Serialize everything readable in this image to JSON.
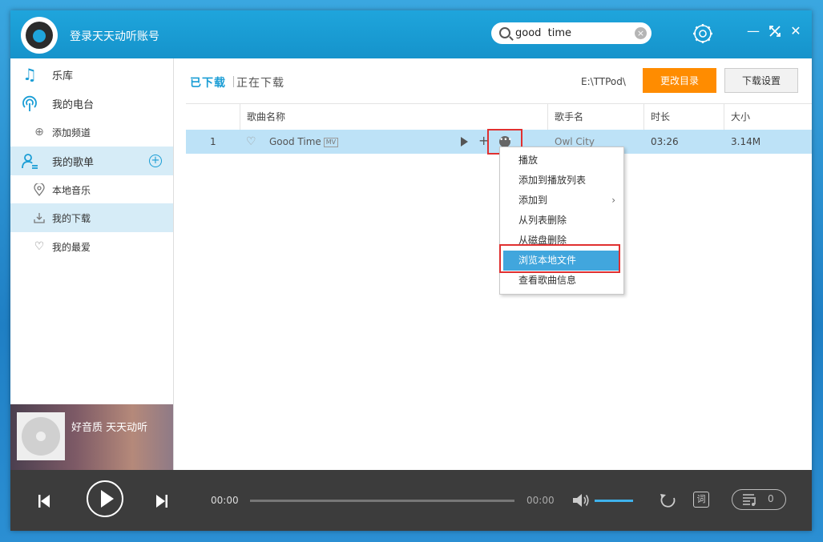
{
  "header": {
    "login_label": "登录天天动听账号",
    "search_value": "good  time",
    "search_clear": "×"
  },
  "window_controls": {
    "minimize": "—",
    "restore": "✕",
    "close": "✕"
  },
  "sidebar": {
    "items": [
      {
        "label": "乐库"
      },
      {
        "label": "我的电台"
      },
      {
        "label": "添加频道"
      },
      {
        "label": "我的歌单"
      },
      {
        "label": "本地音乐"
      },
      {
        "label": "我的下载"
      },
      {
        "label": "我的最爱"
      }
    ],
    "add_symbol": "+",
    "promo_text": "好音质 天天动听"
  },
  "main": {
    "tabs": [
      {
        "label": "已下载"
      },
      {
        "label": "正在下载"
      }
    ],
    "path": "E:\\TTPod\\",
    "change_dir_label": "更改目录",
    "download_settings_label": "下载设置",
    "columns": [
      "歌曲名称",
      "歌手名",
      "时长",
      "大小"
    ],
    "rows": [
      {
        "index": "1",
        "title": "Good Time",
        "mv": "MV",
        "artist": "Owl City",
        "duration": "03:26",
        "size": "3.14M"
      }
    ],
    "row_add": "+",
    "row_more": "•••"
  },
  "context_menu": {
    "items": [
      {
        "label": "播放"
      },
      {
        "label": "添加到播放列表"
      },
      {
        "label": "添加到",
        "arrow": "›"
      },
      {
        "label": "从列表删除"
      },
      {
        "label": "从磁盘删除"
      },
      {
        "label": "浏览本地文件",
        "highlighted": true
      },
      {
        "label": "查看歌曲信息"
      }
    ]
  },
  "player": {
    "current_time": "00:00",
    "total_time": "00:00",
    "progress": 0,
    "volume": 1.0,
    "lyric_label": "词",
    "queue_count": "0"
  },
  "colors": {
    "accent": "#1a9dd5",
    "orange": "#ff8c00",
    "highlight": "#41a6dd",
    "annotation_red": "#e03030"
  }
}
